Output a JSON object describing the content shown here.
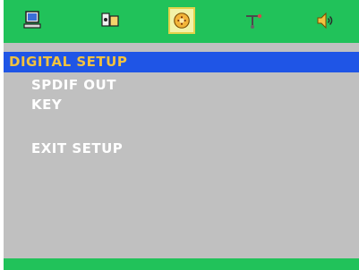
{
  "tabs": [
    {
      "icon": "computer-monitor-icon"
    },
    {
      "icon": "audio-video-icon"
    },
    {
      "icon": "digital-setup-icon",
      "active": true
    },
    {
      "icon": "speaker-setup-icon"
    },
    {
      "icon": "speaker-volume-icon"
    }
  ],
  "section_title": "DIGITAL SETUP",
  "menu": {
    "items": [
      "SPDIF OUT",
      "KEY"
    ],
    "exit": "EXIT SETUP"
  },
  "colors": {
    "bar_green": "#21c25a",
    "title_blue": "#1f55e6",
    "title_text": "#f2c23f",
    "panel_gray": "#c0c0c0"
  }
}
